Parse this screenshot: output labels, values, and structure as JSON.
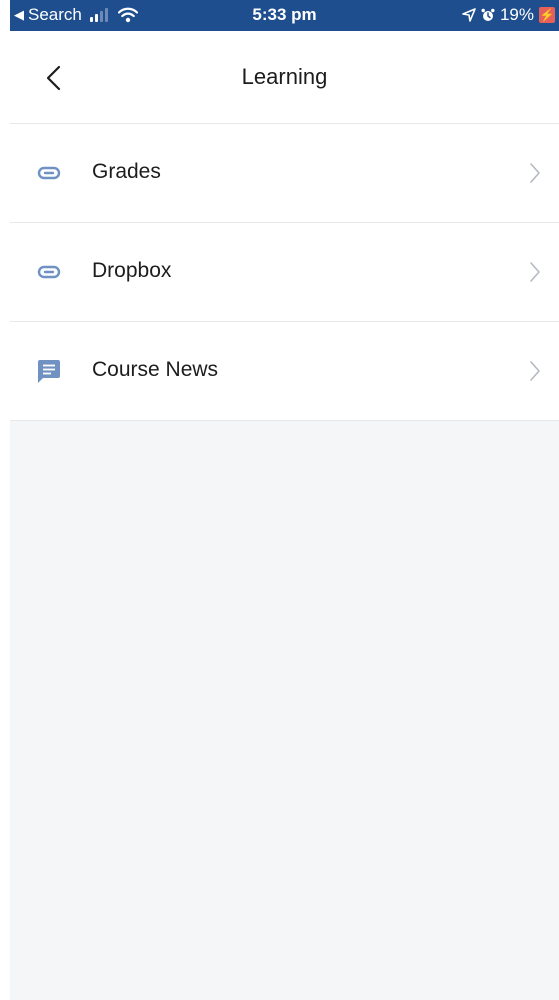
{
  "status_bar": {
    "back_app": "Search",
    "time": "5:33 pm",
    "battery": "19%",
    "battery_icon": "battery-charging-icon",
    "colors": {
      "background": "#1f4e8f",
      "battery": "#e6605a"
    }
  },
  "header": {
    "title": "Learning",
    "back_icon": "chevron-left-icon"
  },
  "menu": {
    "items": [
      {
        "label": "Grades",
        "icon": "link-icon"
      },
      {
        "label": "Dropbox",
        "icon": "link-icon"
      },
      {
        "label": "Course News",
        "icon": "message-icon"
      }
    ]
  },
  "colors": {
    "icon": "#6f92c2",
    "chevron": "#b5b9c1",
    "divider": "#e6e8ec",
    "empty_background": "#f5f6f8"
  }
}
